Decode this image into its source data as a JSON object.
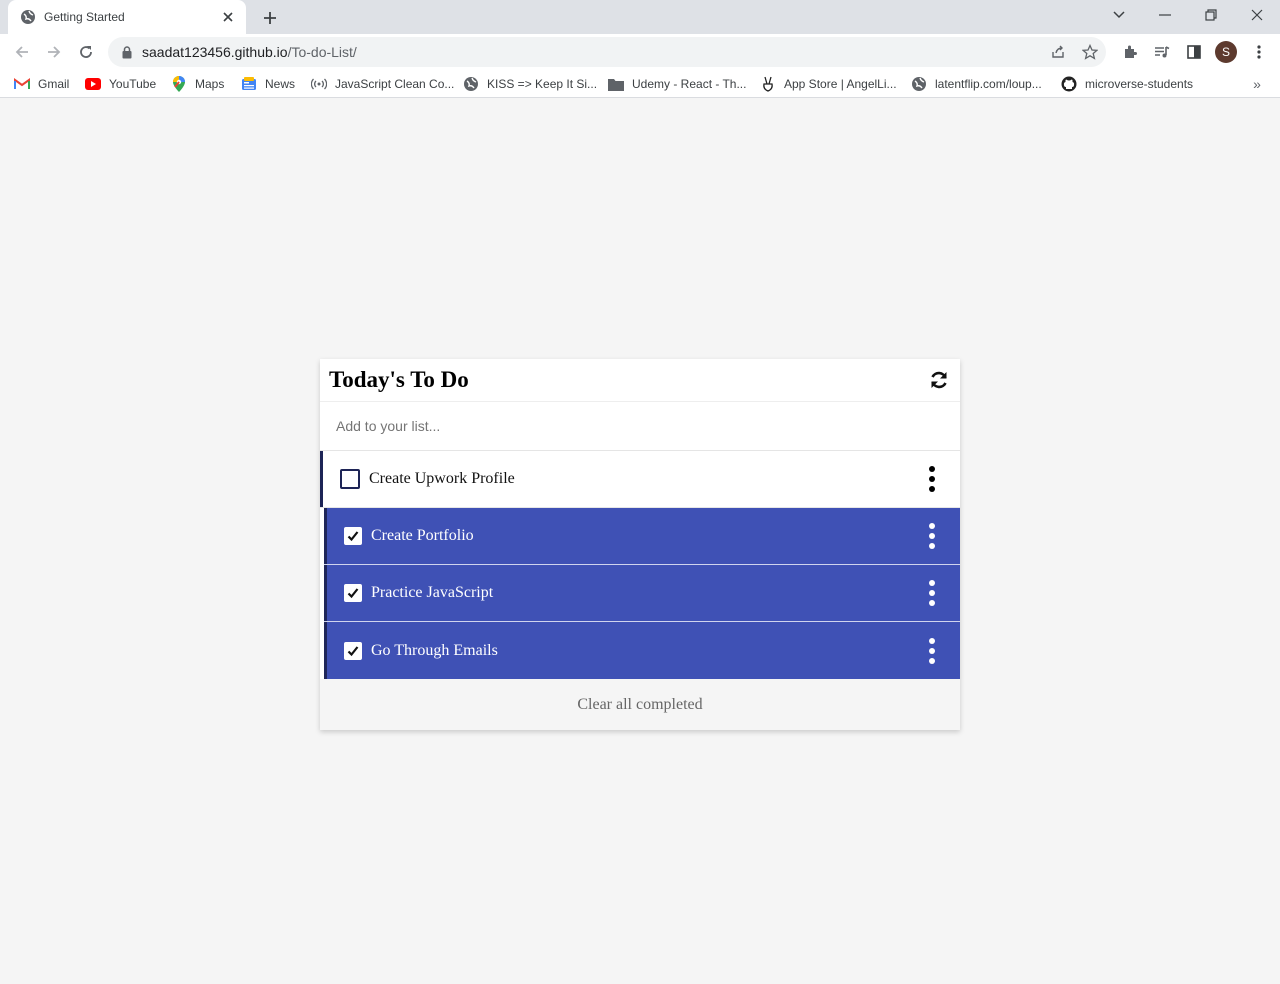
{
  "browser": {
    "tab_title": "Getting Started",
    "url_host": "saadat123456.github.io",
    "url_path": "/To-do-List/",
    "avatar_letter": "S",
    "bookmarks": [
      {
        "label": "Gmail",
        "icon": "gmail-icon"
      },
      {
        "label": "YouTube",
        "icon": "youtube-icon"
      },
      {
        "label": "Maps",
        "icon": "maps-icon"
      },
      {
        "label": "News",
        "icon": "news-icon"
      },
      {
        "label": "JavaScript Clean Co...",
        "icon": "podcast-icon"
      },
      {
        "label": "KISS => Keep It Si...",
        "icon": "globe-icon"
      },
      {
        "label": "Udemy - React - Th...",
        "icon": "folder-icon"
      },
      {
        "label": "App Store | AngelLi...",
        "icon": "angellist-icon"
      },
      {
        "label": "latentflip.com/loup...",
        "icon": "globe-icon"
      },
      {
        "label": "microverse-students",
        "icon": "github-icon"
      }
    ],
    "bookmarks_overflow": "»"
  },
  "todo": {
    "title": "Today's To Do",
    "input_placeholder": "Add to your list...",
    "items": [
      {
        "text": "Create Upwork Profile",
        "completed": false
      },
      {
        "text": "Create Portfolio",
        "completed": true
      },
      {
        "text": "Practice JavaScript",
        "completed": true
      },
      {
        "text": "Go Through Emails",
        "completed": true
      }
    ],
    "clear_label": "Clear all completed"
  },
  "colors": {
    "completed_bg": "#3f51b5",
    "accent_edge": "#1d2456",
    "page_bg": "#f5f5f5"
  }
}
